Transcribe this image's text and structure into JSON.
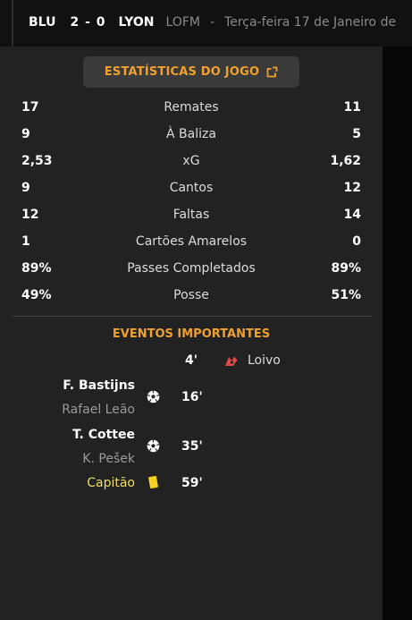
{
  "header": {
    "home": "BLU",
    "score": "2 - 0",
    "away": "LYON",
    "competition": "LOFM",
    "separator": "-",
    "date": "Terça-feira 17 de Janeiro de"
  },
  "stats_button": {
    "label": "ESTATÍSTICAS DO JOGO",
    "icon": "external-link-icon"
  },
  "stats": [
    {
      "home": "17",
      "label": "Remates",
      "away": "11"
    },
    {
      "home": "9",
      "label": "À Baliza",
      "away": "5"
    },
    {
      "home": "2,53",
      "label": "xG",
      "away": "1,62"
    },
    {
      "home": "9",
      "label": "Cantos",
      "away": "12"
    },
    {
      "home": "12",
      "label": "Faltas",
      "away": "14"
    },
    {
      "home": "1",
      "label": "Cartões Amarelos",
      "away": "0"
    },
    {
      "home": "89%",
      "label": "Passes Completados",
      "away": "89%"
    },
    {
      "home": "49%",
      "label": "Posse",
      "away": "51%"
    }
  ],
  "events": {
    "title": "EVENTOS IMPORTANTES",
    "items": [
      {
        "minute": "4'",
        "side": "away",
        "icon": "injury-icon",
        "text": "Loivo"
      },
      {
        "minute": "16'",
        "side": "home",
        "icon": "goal-ball-icon",
        "player": "F. Bastijns",
        "assist": "Rafael Leão"
      },
      {
        "minute": "35'",
        "side": "home",
        "icon": "goal-ball-icon",
        "player": "T. Cottee",
        "assist": "K. Pešek"
      },
      {
        "minute": "59'",
        "side": "home",
        "icon": "yellow-card-icon",
        "player": "Capitão"
      }
    ]
  },
  "colors": {
    "accent": "#f0a02e",
    "captain": "#f0dc63",
    "yellow_card": "#f5d01e",
    "injury": "#e0464a"
  }
}
